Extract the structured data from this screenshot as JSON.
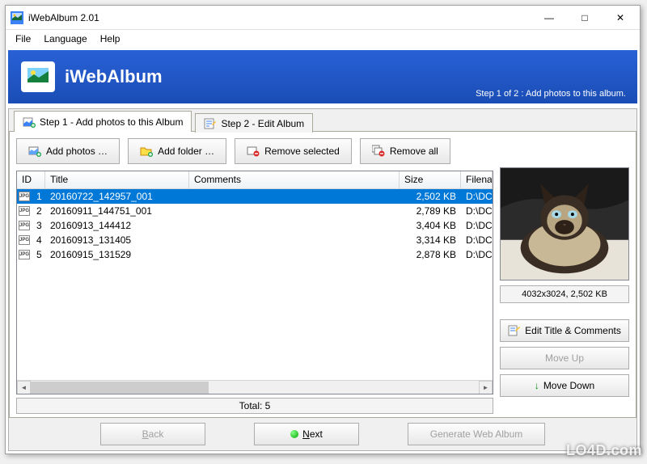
{
  "window": {
    "title": "iWebAlbum 2.01",
    "minimize": "—",
    "maximize": "□",
    "close": "✕"
  },
  "menu": {
    "file": "File",
    "language": "Language",
    "help": "Help"
  },
  "banner": {
    "title": "iWebAlbum",
    "step": "Step 1 of 2 : Add photos to this album."
  },
  "tabs": {
    "step1": "Step 1 - Add photos to this Album",
    "step2": "Step 2 - Edit Album"
  },
  "toolbar": {
    "add_photos": "Add photos …",
    "add_folder": "Add folder …",
    "remove_selected": "Remove selected",
    "remove_all": "Remove all"
  },
  "columns": {
    "id": "ID",
    "title": "Title",
    "comments": "Comments",
    "size": "Size",
    "filename": "Filename"
  },
  "rows": [
    {
      "id": "1",
      "title": "20160722_142957_001",
      "comments": "",
      "size": "2,502 KB",
      "filename": "D:\\DCIM\\C",
      "selected": true
    },
    {
      "id": "2",
      "title": "20160911_144751_001",
      "comments": "",
      "size": "2,789 KB",
      "filename": "D:\\DCIM\\C",
      "selected": false
    },
    {
      "id": "3",
      "title": "20160913_144412",
      "comments": "",
      "size": "3,404 KB",
      "filename": "D:\\DCIM\\C",
      "selected": false
    },
    {
      "id": "4",
      "title": "20160913_131405",
      "comments": "",
      "size": "3,314 KB",
      "filename": "D:\\DCIM\\C",
      "selected": false
    },
    {
      "id": "5",
      "title": "20160915_131529",
      "comments": "",
      "size": "2,878 KB",
      "filename": "D:\\DCIM\\C",
      "selected": false
    }
  ],
  "total": "Total: 5",
  "preview": {
    "info": "4032x3024, 2,502 KB"
  },
  "side": {
    "edit": "Edit Title & Comments",
    "move_up": "Move Up",
    "move_down": "Move Down"
  },
  "footer": {
    "back": "Back",
    "next": "Next",
    "generate": "Generate Web Album"
  },
  "watermark": "LO4D.com"
}
